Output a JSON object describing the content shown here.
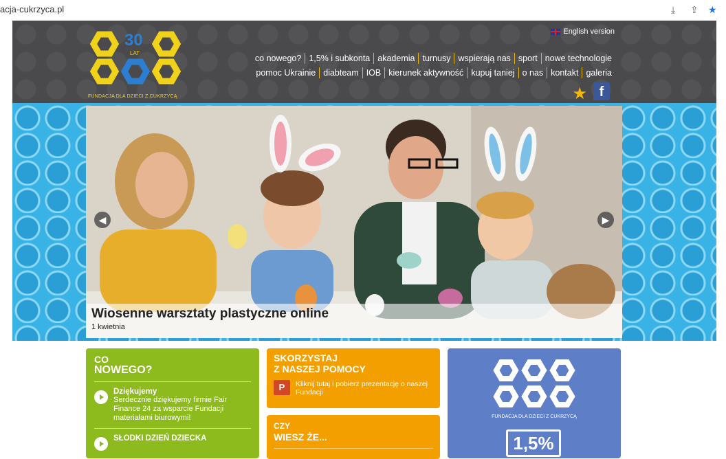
{
  "browser": {
    "url": "acja-cukrzyca.pl"
  },
  "header": {
    "logo_years": "30",
    "logo_lat": "LAT",
    "logo_tagline": "FUNDACJA DLA DZIECI Z CUKRZYCĄ",
    "english_version": "English version",
    "nav_row1": [
      "co nowego?",
      "1,5% i subkonta",
      "akademia",
      "turnusy",
      "wspierają nas",
      "sport",
      "nowe technologie"
    ],
    "nav_row2": [
      "pomoc Ukrainie",
      "diabteam",
      "IOB",
      "kierunek aktywność",
      "kupuj taniej",
      "o nas",
      "kontakt",
      "galeria"
    ],
    "fb_label": "f"
  },
  "hero": {
    "title": "Wiosenne warsztaty plastyczne online",
    "date": "1 kwietnia"
  },
  "news_box": {
    "heading_line1": "CO",
    "heading_line2": "NOWEGO?",
    "items": [
      {
        "title": "Dziękujemy",
        "desc": "Serdecznie dziękujemy firmie Fair Finance 24 za wsparcie Fundacji materiałami biurowymi!"
      },
      {
        "title": "SŁODKI DZIEŃ DZIECKA",
        "desc": ""
      }
    ]
  },
  "help_box": {
    "heading_line1": "SKORZYSTAJ",
    "heading_line2": "Z NASZEJ POMOCY",
    "ppt_icon": "P",
    "text": "Kliknij tutaj i pobierz prezentację o naszej Fundacji"
  },
  "didyouknow_box": {
    "heading_line1": "CZY",
    "heading_line2": "WIESZ ŻE..."
  },
  "blue_box": {
    "tagline": "FUNDACJA DLA DZIECI Z CUKRZYCĄ",
    "percent": "1,5%"
  },
  "colors": {
    "header_bg": "#4a4a4c",
    "hero_bg": "#39b3e6",
    "green": "#8dbb1e",
    "orange": "#f49f00",
    "blue": "#5f7ec8",
    "logo_yellow": "#f1d21a"
  }
}
